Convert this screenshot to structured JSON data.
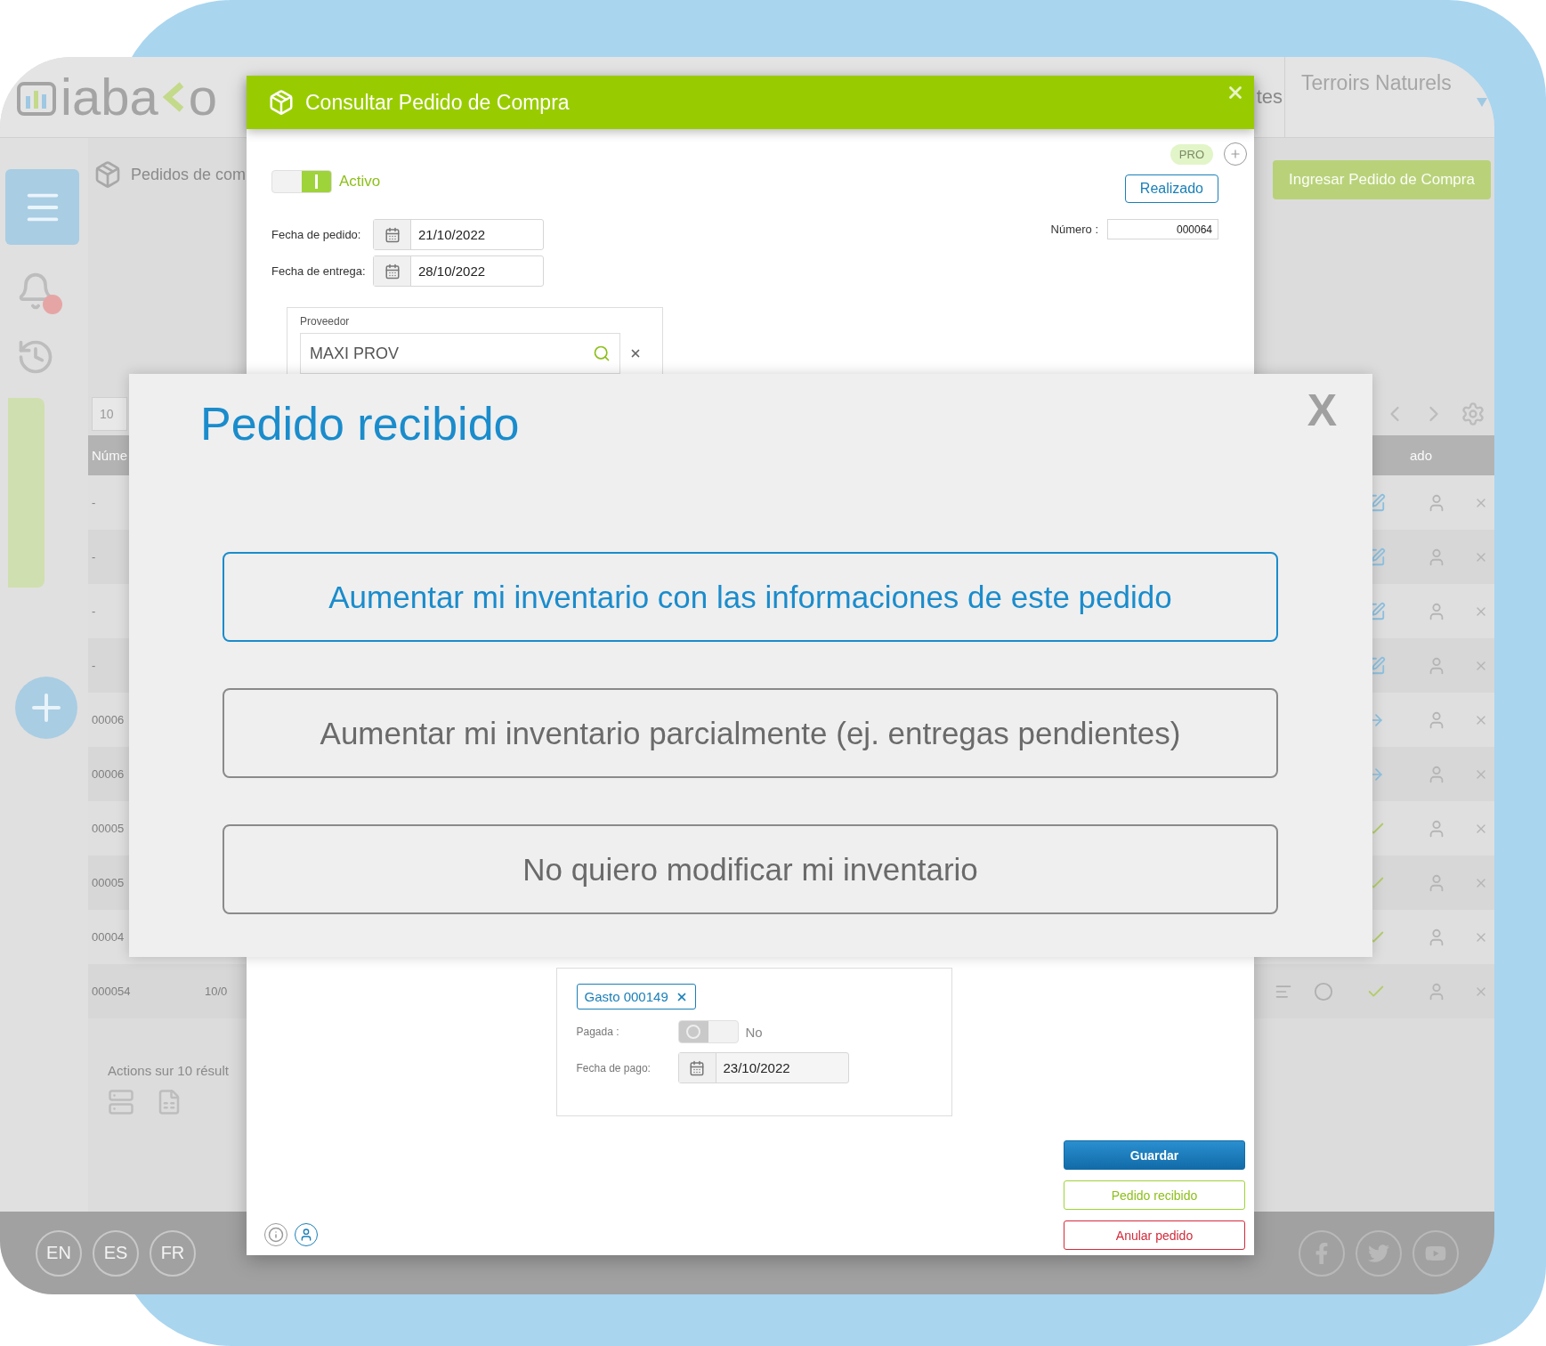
{
  "app": {
    "logo": {
      "before": "iaba",
      "after": "o"
    },
    "header_tab": "tes",
    "account": {
      "company": "Terroirs Naturels"
    },
    "page_title": "Pedidos de com",
    "new_button": "Ingresar Pedido de Compra",
    "page_size": "10",
    "table": {
      "columns": [
        "Núme",
        "ado"
      ],
      "rows": [
        {
          "number": "-",
          "kind": "edit"
        },
        {
          "number": "-",
          "kind": "edit"
        },
        {
          "number": "-",
          "kind": "edit"
        },
        {
          "number": "-",
          "kind": "edit"
        },
        {
          "number": "00006",
          "kind": "sent"
        },
        {
          "number": "00006",
          "kind": "sent"
        },
        {
          "number": "00005",
          "kind": "done"
        },
        {
          "number": "00005",
          "kind": "done"
        },
        {
          "number": "00004",
          "kind": "done"
        },
        {
          "number": "000054",
          "date": "10/0",
          "kind": "done",
          "note_icons": true
        }
      ]
    },
    "actions_label": "Actions sur 10 résult",
    "languages": [
      "EN",
      "ES",
      "FR"
    ]
  },
  "purchase_order_dialog": {
    "title": "Consultar Pedido de Compra",
    "plan_badge": "PRO",
    "active": {
      "on": true,
      "label": "Activo"
    },
    "status_button": "Realizado",
    "order_date": {
      "label": "Fecha de pedido:",
      "value": "21/10/2022"
    },
    "delivery_date": {
      "label": "Fecha de entrega:",
      "value": "28/10/2022"
    },
    "number": {
      "label": "Número :",
      "value": "000064"
    },
    "supplier": {
      "label": "Proveedor",
      "value": "MAXI PROV"
    },
    "expense": {
      "chip": "Gasto 000149",
      "paid": {
        "label": "Pagada :",
        "on": false,
        "text": "No"
      },
      "payment_date": {
        "label": "Fecha de pago:",
        "value": "23/10/2022"
      }
    },
    "buttons": [
      {
        "label": "Guardar",
        "kind": "primary"
      },
      {
        "label": "Pedido recibido",
        "kind": "success"
      },
      {
        "label": "Anular pedido",
        "kind": "danger"
      }
    ]
  },
  "received_dialog": {
    "title": "Pedido recibido",
    "close": "X",
    "options": [
      {
        "label": "Aumentar mi inventario con las informaciones de este pedido",
        "selected": true
      },
      {
        "label": "Aumentar mi inventario parcialmente (ej. entregas pendientes)",
        "selected": false
      },
      {
        "label": "No quiero modificar mi inventario",
        "selected": false
      }
    ]
  }
}
